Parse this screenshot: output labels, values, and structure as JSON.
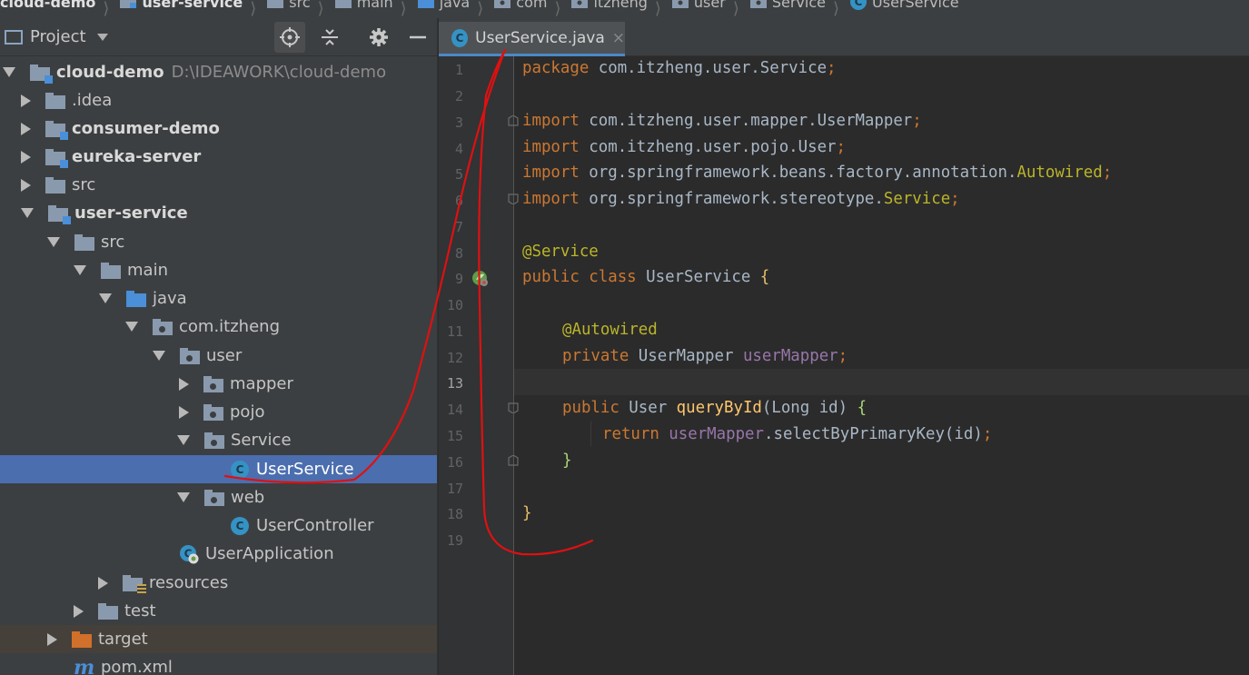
{
  "breadcrumb": [
    {
      "label": "cloud-demo",
      "bold": true
    },
    {
      "label": "user-service",
      "bold": true
    },
    {
      "label": "src"
    },
    {
      "label": "main"
    },
    {
      "label": "java"
    },
    {
      "label": "com"
    },
    {
      "label": "itzheng"
    },
    {
      "label": "user"
    },
    {
      "label": "Service"
    },
    {
      "label": "UserService"
    }
  ],
  "project_panel": {
    "title": "Project",
    "tree": [
      {
        "label": "cloud-demo",
        "path": "D:\\IDEAWORK\\cloud-demo"
      },
      {
        "label": ".idea"
      },
      {
        "label": "consumer-demo"
      },
      {
        "label": "eureka-server"
      },
      {
        "label": "src"
      },
      {
        "label": "user-service"
      },
      {
        "label": "src"
      },
      {
        "label": "main"
      },
      {
        "label": "java"
      },
      {
        "label": "com.itzheng"
      },
      {
        "label": "user"
      },
      {
        "label": "mapper"
      },
      {
        "label": "pojo"
      },
      {
        "label": "Service"
      },
      {
        "label": "UserService"
      },
      {
        "label": "web"
      },
      {
        "label": "UserController"
      },
      {
        "label": "UserApplication"
      },
      {
        "label": "resources"
      },
      {
        "label": "test"
      },
      {
        "label": "target"
      },
      {
        "label": "pom.xml"
      }
    ]
  },
  "editor": {
    "tab_label": "UserService.java",
    "tab_close": "×",
    "class_icon_letter": "C",
    "maven_icon_letter": "m",
    "current_line": 13,
    "line_numbers": [
      "1",
      "2",
      "3",
      "4",
      "5",
      "6",
      "7",
      "8",
      "9",
      "10",
      "11",
      "12",
      "13",
      "14",
      "15",
      "16",
      "17",
      "18",
      "19"
    ],
    "code": {
      "l1_kw": "package ",
      "l1_rest": "com.itzheng.user.Service",
      "l1_semi": ";",
      "l3_kw": "import ",
      "l3_rest": "com.itzheng.user.mapper.UserMapper",
      "l3_semi": ";",
      "l4_kw": "import ",
      "l4_rest": "com.itzheng.user.pojo.User",
      "l4_semi": ";",
      "l5_kw": "import ",
      "l5_rest": "org.springframework.beans.factory.annotation.",
      "l5_ann": "Autowired",
      "l5_semi": ";",
      "l6_kw": "import ",
      "l6_rest": "org.springframework.stereotype.",
      "l6_ann": "Service",
      "l6_semi": ";",
      "l8_ann": "@Service",
      "l9_kw": "public class ",
      "l9_name": "UserService ",
      "l9_brace": "{",
      "l11_ann": "@Autowired",
      "l12_kw": "private ",
      "l12_type": "UserMapper ",
      "l12_field": "userMapper",
      "l12_semi": ";",
      "l14_kw": "public ",
      "l14_type": "User ",
      "l14_method": "queryById",
      "l14_params": "(Long id) ",
      "l14_brace": "{",
      "l15_kw": "return ",
      "l15_field": "userMapper",
      "l15_call": ".selectByPrimaryKey(id)",
      "l15_semi": ";",
      "l16_brace": "}",
      "l18_brace": "}"
    }
  },
  "colors": {
    "panel_bg": "#3c3f41",
    "editor_bg": "#2b2b2b",
    "selection": "#4b6eaf",
    "keyword": "#cc7832",
    "annotation": "#bbb529",
    "field": "#9876aa",
    "method": "#ffc66d",
    "text": "#a9b7c6",
    "red_annotation": "#e01010"
  },
  "icons": [
    "folder-icon",
    "module-icon",
    "package-icon",
    "class-icon",
    "spring-app-icon",
    "maven-icon",
    "locate-icon",
    "collapse-icon",
    "gear-icon",
    "minimize-icon",
    "spring-bean-gutter-icon",
    "fold-marker-icon"
  ]
}
